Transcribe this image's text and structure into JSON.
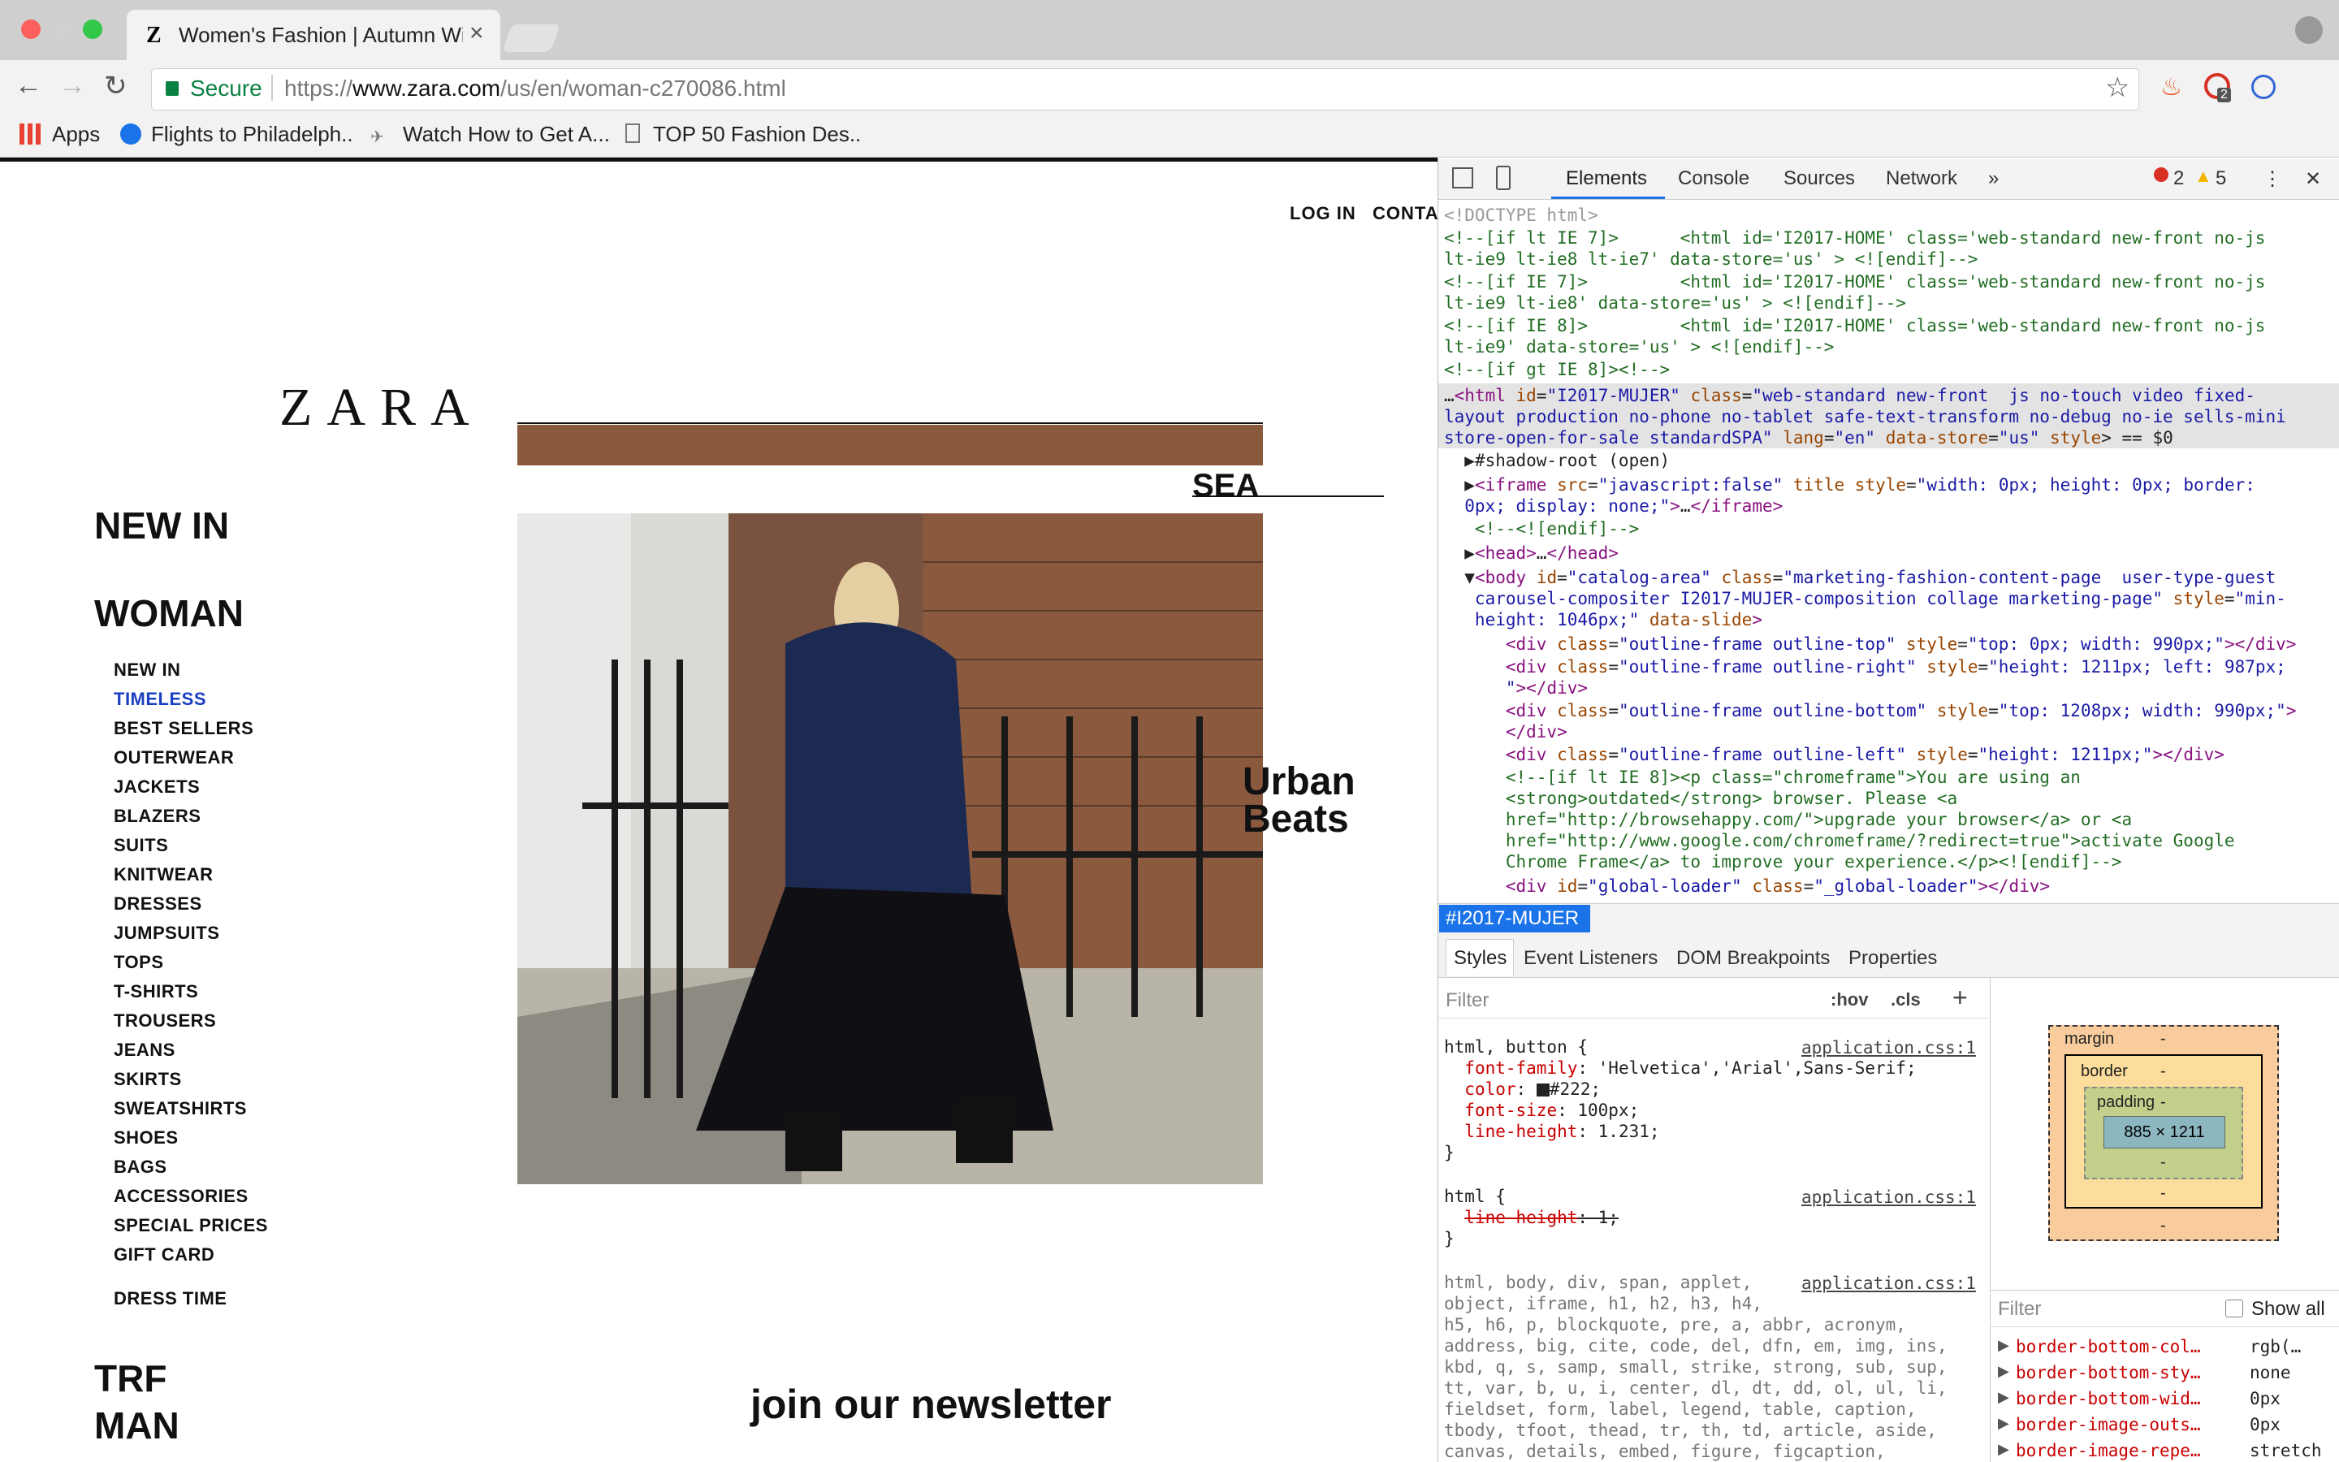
{
  "browser": {
    "tab_title": "Women's Fashion | Autumn Winter",
    "secure_label": "Secure",
    "url_scheme": "https://",
    "url_host": "www.zara.com",
    "url_path": "/us/en/woman-c270086.html",
    "bookmarks": [
      "Apps",
      "Flights to Philadelph..",
      "Watch How to Get A...",
      "TOP 50 Fashion Des.."
    ],
    "badge_count": "2"
  },
  "page": {
    "topnav": {
      "login": "LOG IN",
      "contact": "CONTA"
    },
    "logo": "ZARA",
    "new_in_heading": "NEW IN",
    "woman_heading": "WOMAN",
    "categories": [
      "NEW IN",
      "TIMELESS",
      "BEST SELLERS",
      "OUTERWEAR",
      "JACKETS",
      "BLAZERS",
      "SUITS",
      "KNITWEAR",
      "DRESSES",
      "JUMPSUITS",
      "TOPS",
      "T-SHIRTS",
      "TROUSERS",
      "JEANS",
      "SKIRTS",
      "SWEATSHIRTS",
      "SHOES",
      "BAGS",
      "ACCESSORIES",
      "SPECIAL PRICES",
      "GIFT CARD"
    ],
    "active_category_color": "#1a3fc0",
    "dress_time": "DRESS TIME",
    "trf": "TRF",
    "man": "MAN",
    "search_fragment": "SEA",
    "urban_line1": "Urban",
    "urban_line2": "Beats",
    "newsletter": "join our newsletter"
  },
  "devtools": {
    "tabs": [
      "Elements",
      "Console",
      "Sources",
      "Network"
    ],
    "errors": "2",
    "warnings": "5",
    "breadcrumb": "#I2017-MUJER",
    "styles_tabs": [
      "Styles",
      "Event Listeners",
      "DOM Breakpoints",
      "Properties"
    ],
    "filter_placeholder": "Filter",
    "hov": ":hov",
    "cls": ".cls",
    "css_source": "application.css:1",
    "box_labels": {
      "margin": "margin",
      "border": "border",
      "padding": "padding",
      "content": "885 × 1211",
      "dash": "-"
    },
    "computed_filter": "Filter",
    "show_all": "Show all",
    "computed": [
      {
        "prop": "border-bottom-col…",
        "val": "rgb(…"
      },
      {
        "prop": "border-bottom-sty…",
        "val": "none"
      },
      {
        "prop": "border-bottom-wid…",
        "val": "0px"
      },
      {
        "prop": "border-image-outs…",
        "val": "0px"
      },
      {
        "prop": "border-image-repe…",
        "val": "stretch"
      }
    ]
  }
}
